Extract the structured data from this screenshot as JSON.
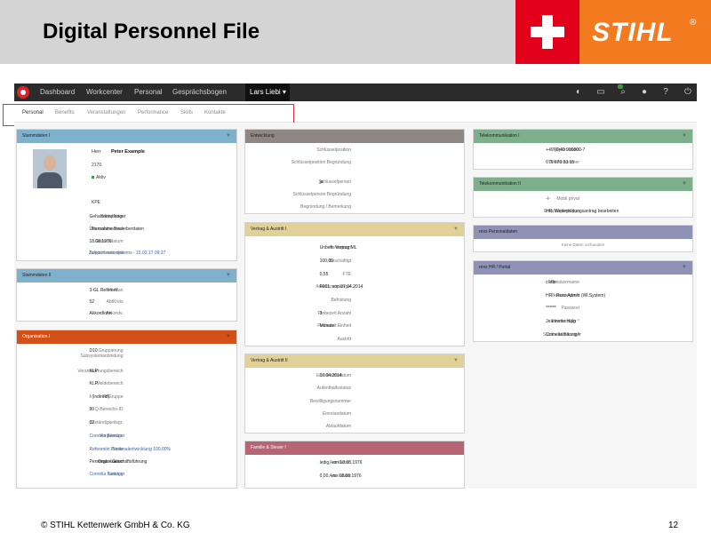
{
  "slide": {
    "title": "Digital Personnel File",
    "footer": "© STIHL Kettenwerk GmbH & Co. KG",
    "page_number": "12",
    "logo_text": "STIHL",
    "logo_reg": "®"
  },
  "nav": {
    "items": [
      "Dashboard",
      "Workcenter",
      "Personal",
      "Gesprächsbogen"
    ],
    "user": "Lars Liebi ▾",
    "icons": [
      "globe-icon",
      "cart-icon",
      "search-icon",
      "user-icon",
      "help-icon",
      "power-icon"
    ]
  },
  "tabs": [
    "Personal",
    "Benefits",
    "Veranstaltungen",
    "Performance",
    "Skills",
    "Kontakte"
  ],
  "colors": {
    "accent_red": "#d9323a",
    "stihl_orange": "#f37a1f",
    "swiss_red": "#e2001a"
  },
  "panels": {
    "stammdaten1": {
      "title": "Stammdaten I",
      "salutation": "Herr",
      "name": "Peter Example",
      "number": "2170",
      "status": "Aktiv",
      "rows": [
        {
          "label": "",
          "value": "KPE"
        },
        {
          "label": "Mitarbeiter",
          "value": "Gehaltsempfänger"
        },
        {
          "label": "Massnahmenart",
          "value": "Übernahme Bewerberdaten"
        },
        {
          "label": "Geburtsdatum",
          "value": "18.08.1976"
        },
        {
          "label": "Zuletzt bearbeitet",
          "value": "Support rexx systems - 15.03.17 09:27"
        }
      ]
    },
    "stammdaten2": {
      "title": "Stammdaten II",
      "rows": [
        {
          "label": "FK-Plan",
          "value": "3-GL Referent"
        },
        {
          "label": "AbtKreis",
          "value": "52"
        },
        {
          "label": "Akkordv.",
          "value": "Akkordlohn"
        }
      ]
    },
    "organisation": {
      "title": "Organisation I",
      "rows": [
        {
          "label": "Gruppierung Subsystemanbindung",
          "value": "D10"
        },
        {
          "label": "Verantwortungsbereich",
          "value": "KLP"
        },
        {
          "label": "Meldebereich",
          "value": "KLP"
        },
        {
          "label": "TiffGruppe",
          "value": "I (Indirekt)"
        },
        {
          "label": "Q-Bereichs-ID",
          "value": "80"
        },
        {
          "label": "Zuständigkeitsgr.",
          "value": "02"
        },
        {
          "label": "Vorgesetzte",
          "value": "Cornelia Bänziger"
        },
        {
          "label": "Stelle",
          "value": "Referentin Personalentwicklung 100,00%"
        },
        {
          "label": "Organisation",
          "value": "Personal > Geschäftsführung"
        },
        {
          "label": "Leitung",
          "value": "Cornelia Bänziger"
        }
      ]
    },
    "entwicklung": {
      "title": "Entwicklung",
      "rows": [
        {
          "label": "Schlüsselposition",
          "value": ""
        },
        {
          "label": "Schlüsselposition Begründung",
          "value": ""
        },
        {
          "label": "Schlüsselperson",
          "value": "ja"
        },
        {
          "label": "Schlüsselperson Begründung",
          "value": ""
        },
        {
          "label": "Begründung / Bemerkung",
          "value": ""
        }
      ]
    },
    "vertrag1": {
      "title": "Vertrag & Austritt I",
      "rows": [
        {
          "label": "Vertragsart",
          "value": "Unbefr. Vertrag ML"
        },
        {
          "label": "Beschäftigt",
          "value": "100,00"
        },
        {
          "label": "FTE",
          "value": "0,55"
        },
        {
          "label": "Arbeitszeitplangel",
          "value": "F001, von 07.04.2014"
        },
        {
          "label": "Befristung",
          "value": ""
        },
        {
          "label": "Probezeit Anzahl",
          "value": "3"
        },
        {
          "label": "Probezeit Einheit",
          "value": "Monate"
        },
        {
          "label": "Austritt",
          "value": ""
        }
      ]
    },
    "vertrag2": {
      "title": "Vertrag & Austritt II",
      "rows": [
        {
          "label": "Ersteintrittsdatum",
          "value": "07.04.2014"
        },
        {
          "label": "Aufenthaltsstatus",
          "value": ""
        },
        {
          "label": "Bewilligungsnummer",
          "value": ""
        },
        {
          "label": "Einreisedatum",
          "value": ""
        },
        {
          "label": "Ablaufdatum",
          "value": ""
        }
      ]
    },
    "familie": {
      "title": "Familie & Steuer I",
      "rows": [
        {
          "label": "Familienst.",
          "value": "ledig, von 18.08.1976"
        },
        {
          "label": "Anz Kinder",
          "value": "0,00, von 18.08.1976"
        }
      ]
    },
    "telekom1": {
      "title": "Telekommunikation I",
      "rows": [
        {
          "label": "Telefon intern",
          "value": "+49 (0)40 900800-7"
        },
        {
          "label": "Telefonnummer",
          "value": "079 670 33 15"
        }
      ]
    },
    "telekom2": {
      "title": "Telekommunikation II",
      "rows": [
        {
          "label": "Mobil privat",
          "value": "-/-"
        },
        {
          "label": "Empfängergruppe",
          "value": "HR, Weiterbildungsantrag bearbeiten"
        }
      ]
    },
    "rexx_personal": {
      "title": "rexx Personaldaten",
      "empty_text": "Keine Daten vorhanden!"
    },
    "rexx_hr": {
      "title": "rexx HR / Portal",
      "rows": [
        {
          "label": "Benutzername",
          "value": "cliebi"
        },
        {
          "label": "Benutzerprofil",
          "value": "HR - Rexx Admin (Wl.System)"
        },
        {
          "label": "Passwort",
          "value": "******"
        },
        {
          "label": "Tiltemanager *",
          "value": "Jeannette Hälg"
        },
        {
          "label": "Sachbearbeitung *",
          "value": "Cornelia Bänziger"
        }
      ]
    }
  }
}
